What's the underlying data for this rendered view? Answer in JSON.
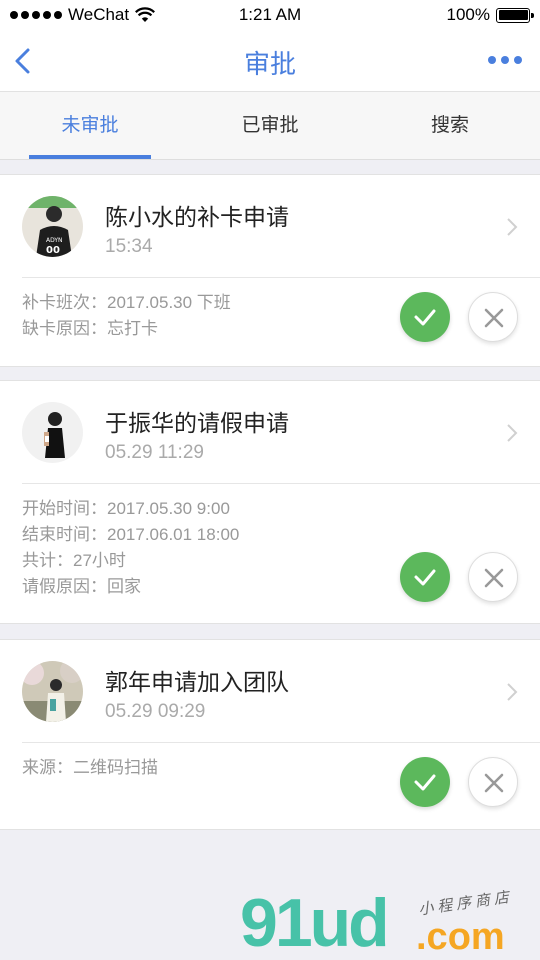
{
  "status_bar": {
    "carrier": "WeChat",
    "time": "1:21 AM",
    "battery": "100%",
    "battery_level": 1.0
  },
  "nav": {
    "title": "审批",
    "back_icon": "chevron-left-icon",
    "more_icon": "more-dots-icon",
    "accent_color": "#4a7fde"
  },
  "tabs": [
    {
      "label": "未审批",
      "active": true
    },
    {
      "label": "已审批",
      "active": false
    },
    {
      "label": "搜索",
      "active": false
    }
  ],
  "requests": [
    {
      "title": "陈小水的补卡申请",
      "time": "15:34",
      "details": [
        "补卡班次：2017.05.30 下班",
        "缺卡原因：忘打卡"
      ]
    },
    {
      "title": "于振华的请假申请",
      "time": "05.29 11:29",
      "details": [
        "开始时间：2017.05.30 9:00",
        "结束时间：2017.06.01 18:00",
        "共计：27小时",
        "请假原因：回家"
      ]
    },
    {
      "title": "郭年申请加入团队",
      "time": "05.29 09:29",
      "details": [
        "来源：二维码扫描"
      ]
    }
  ],
  "actions": {
    "approve_icon": "checkmark-icon",
    "reject_icon": "close-icon",
    "approve_color": "#5cb85c"
  },
  "watermark": {
    "brand": "91ud",
    "suffix": ".com",
    "tagline": "小程序商店"
  }
}
